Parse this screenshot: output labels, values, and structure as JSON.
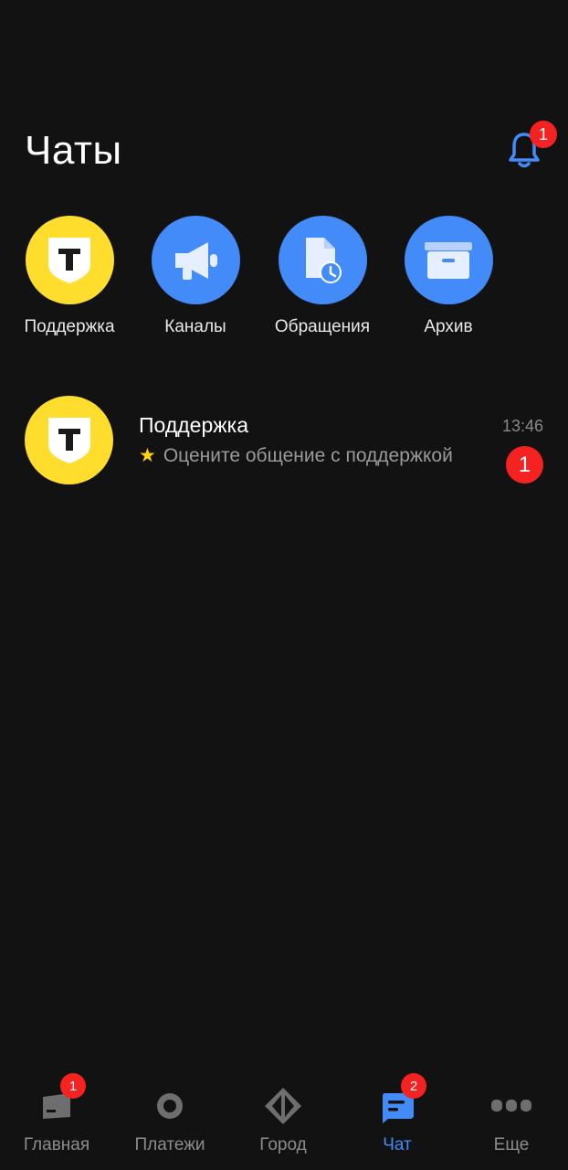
{
  "header": {
    "title": "Чаты",
    "notification_count": "1"
  },
  "quick_actions": [
    {
      "label": "Поддержка",
      "icon": "tinkoff-shield-icon",
      "color": "#ffdd2d"
    },
    {
      "label": "Каналы",
      "icon": "megaphone-icon",
      "color": "#428bf9"
    },
    {
      "label": "Обращения",
      "icon": "document-clock-icon",
      "color": "#428bf9"
    },
    {
      "label": "Архив",
      "icon": "archive-box-icon",
      "color": "#428bf9"
    }
  ],
  "chats": [
    {
      "name": "Поддержка",
      "preview": "Оцените общение с поддержкой",
      "time": "13:46",
      "unread": "1",
      "icon": "tinkoff-shield-icon"
    }
  ],
  "tabbar": {
    "items": [
      {
        "label": "Главная",
        "icon": "home-card-icon",
        "badge": "1",
        "active": false
      },
      {
        "label": "Платежи",
        "icon": "payments-circle-icon",
        "active": false
      },
      {
        "label": "Город",
        "icon": "city-diamond-icon",
        "active": false
      },
      {
        "label": "Чат",
        "icon": "chat-bubble-icon",
        "badge": "2",
        "active": true
      },
      {
        "label": "Еще",
        "icon": "more-dots-icon",
        "active": false
      }
    ]
  },
  "colors": {
    "background": "#121212",
    "accent": "#428bf9",
    "brand_yellow": "#ffdd2d",
    "badge_red": "#f52222"
  }
}
